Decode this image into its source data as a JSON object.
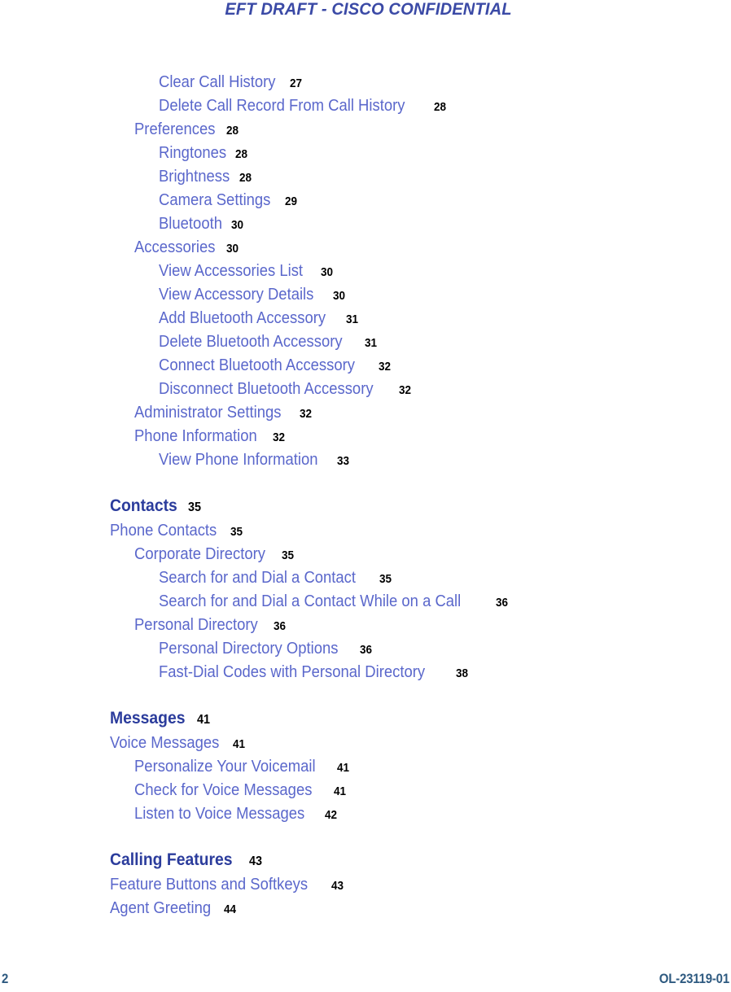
{
  "header": {
    "text": "EFT DRAFT - CISCO CONFIDENTIAL"
  },
  "colors": {
    "header_blue": "#3b4aa6",
    "entry_blue": "#5a67cb",
    "chapter_navy": "#2b3c9c",
    "pageno_black": "#000000",
    "footer_steel": "#2e5a80"
  },
  "toc": {
    "entries": [
      {
        "title": "Clear Call History",
        "page": "27",
        "level": 2,
        "kind": "entry"
      },
      {
        "title": "Delete Call Record From Call History",
        "page": "28",
        "level": 2,
        "kind": "entry"
      },
      {
        "title": "Preferences",
        "page": "28",
        "level": 1,
        "kind": "entry"
      },
      {
        "title": "Ringtones",
        "page": "28",
        "level": 2,
        "kind": "entry"
      },
      {
        "title": "Brightness",
        "page": "28",
        "level": 2,
        "kind": "entry"
      },
      {
        "title": "Camera Settings",
        "page": "29",
        "level": 2,
        "kind": "entry"
      },
      {
        "title": "Bluetooth",
        "page": "30",
        "level": 2,
        "kind": "entry"
      },
      {
        "title": "Accessories",
        "page": "30",
        "level": 1,
        "kind": "entry"
      },
      {
        "title": "View Accessories List",
        "page": "30",
        "level": 2,
        "kind": "entry"
      },
      {
        "title": "View Accessory Details",
        "page": "30",
        "level": 2,
        "kind": "entry"
      },
      {
        "title": "Add Bluetooth Accessory",
        "page": "31",
        "level": 2,
        "kind": "entry"
      },
      {
        "title": "Delete Bluetooth Accessory",
        "page": "31",
        "level": 2,
        "kind": "entry"
      },
      {
        "title": "Connect Bluetooth Accessory",
        "page": "32",
        "level": 2,
        "kind": "entry"
      },
      {
        "title": "Disconnect Bluetooth Accessory",
        "page": "32",
        "level": 2,
        "kind": "entry"
      },
      {
        "title": "Administrator Settings",
        "page": "32",
        "level": 1,
        "kind": "entry"
      },
      {
        "title": "Phone Information",
        "page": "32",
        "level": 1,
        "kind": "entry"
      },
      {
        "title": "View Phone Information",
        "page": "33",
        "level": 2,
        "kind": "entry"
      },
      {
        "title": "Contacts",
        "page": "35",
        "level": 0,
        "kind": "chapter"
      },
      {
        "title": "Phone Contacts",
        "page": "35",
        "level": 0,
        "kind": "entry"
      },
      {
        "title": "Corporate Directory",
        "page": "35",
        "level": 1,
        "kind": "entry"
      },
      {
        "title": "Search for and Dial a Contact",
        "page": "35",
        "level": 2,
        "kind": "entry"
      },
      {
        "title": "Search for and Dial a Contact While on a Call",
        "page": "36",
        "level": 2,
        "kind": "entry"
      },
      {
        "title": "Personal Directory",
        "page": "36",
        "level": 1,
        "kind": "entry"
      },
      {
        "title": "Personal Directory Options",
        "page": "36",
        "level": 2,
        "kind": "entry"
      },
      {
        "title": "Fast-Dial Codes with Personal Directory",
        "page": "38",
        "level": 2,
        "kind": "entry"
      },
      {
        "title": "Messages",
        "page": "41",
        "level": 0,
        "kind": "chapter"
      },
      {
        "title": "Voice Messages",
        "page": "41",
        "level": 0,
        "kind": "entry"
      },
      {
        "title": "Personalize Your Voicemail",
        "page": "41",
        "level": 1,
        "kind": "entry"
      },
      {
        "title": "Check for Voice Messages",
        "page": "41",
        "level": 1,
        "kind": "entry"
      },
      {
        "title": "Listen to Voice Messages",
        "page": "42",
        "level": 1,
        "kind": "entry"
      },
      {
        "title": "Calling Features",
        "page": "43",
        "level": 0,
        "kind": "chapter"
      },
      {
        "title": "Feature Buttons and Softkeys",
        "page": "43",
        "level": 0,
        "kind": "entry"
      },
      {
        "title": "Agent Greeting",
        "page": "44",
        "level": 0,
        "kind": "entry"
      }
    ]
  },
  "footer": {
    "page_number": "2",
    "document_id": "OL-23119-01"
  }
}
